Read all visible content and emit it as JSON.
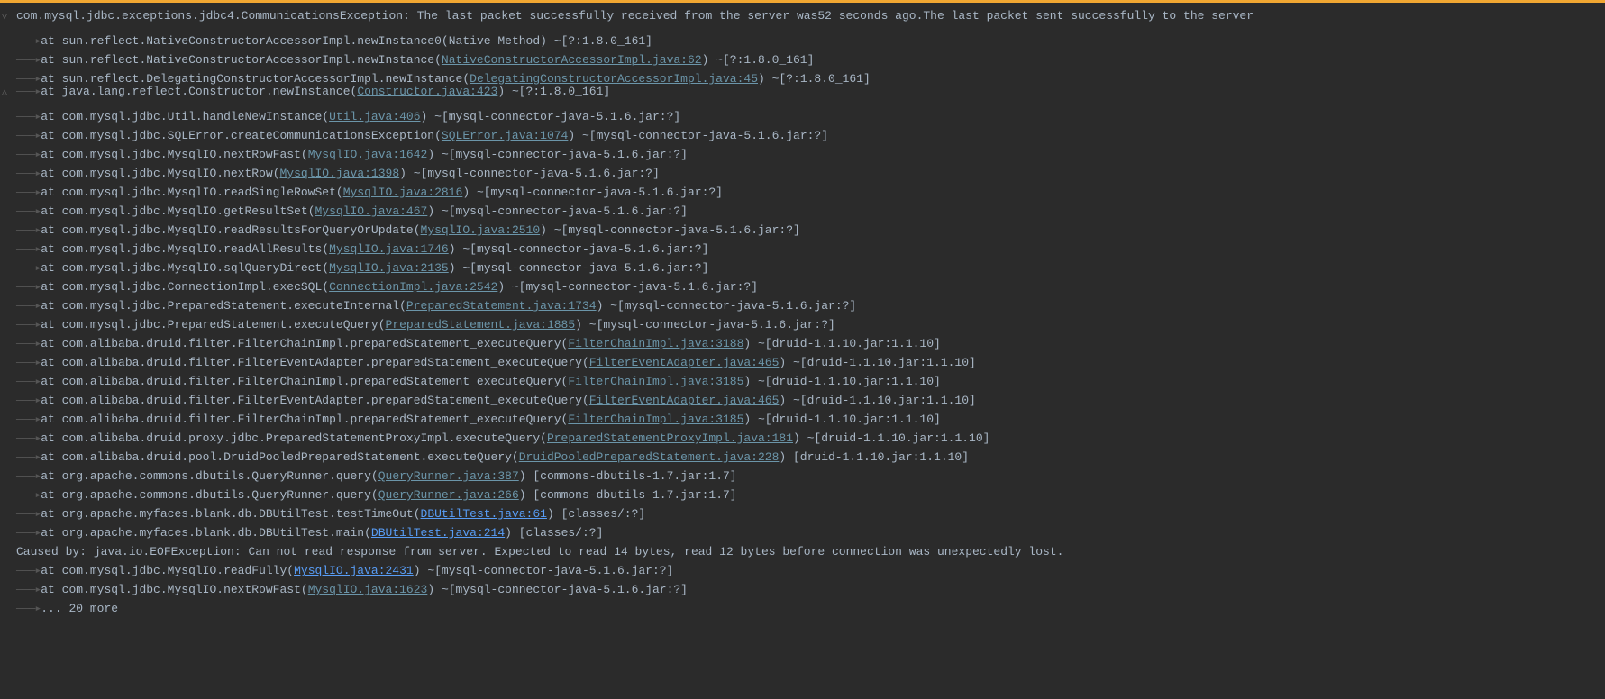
{
  "stacktrace": {
    "header": {
      "gutter": "▽",
      "exception_class": "com.mysql.jdbc.exceptions.jdbc4.CommunicationsException",
      "message": ": The last packet successfully received from the server was52 seconds ago.The last packet sent successfully to the server"
    },
    "frames": [
      {
        "gutter": "",
        "pre": "at ",
        "method": "sun.reflect.NativeConstructorAccessorImpl.newInstance0",
        "paren_open": "(",
        "link": "Native Method",
        "link_type": "plain",
        "paren_close": ")",
        "suffix": " ~[?:1.8.0_161]"
      },
      {
        "gutter": "",
        "pre": "at ",
        "method": "sun.reflect.NativeConstructorAccessorImpl.newInstance",
        "paren_open": "(",
        "link": "NativeConstructorAccessorImpl.java:62",
        "link_type": "link",
        "paren_close": ")",
        "suffix": " ~[?:1.8.0_161]"
      },
      {
        "gutter": "",
        "pre": "at ",
        "method": "sun.reflect.DelegatingConstructorAccessorImpl.newInstance",
        "paren_open": "(",
        "link": "DelegatingConstructorAccessorImpl.java:45",
        "link_type": "link",
        "paren_close": ")",
        "suffix": " ~[?:1.8.0_161]"
      },
      {
        "gutter": "△",
        "pre": "at ",
        "method": "java.lang.reflect.Constructor.newInstance",
        "paren_open": "(",
        "link": "Constructor.java:423",
        "link_type": "link",
        "paren_close": ")",
        "suffix": " ~[?:1.8.0_161]"
      },
      {
        "gutter": "",
        "pre": "at ",
        "method": "com.mysql.jdbc.Util.handleNewInstance",
        "paren_open": "(",
        "link": "Util.java:406",
        "link_type": "link",
        "paren_close": ")",
        "suffix": " ~[mysql-connector-java-5.1.6.jar:?]"
      },
      {
        "gutter": "",
        "pre": "at ",
        "method": "com.mysql.jdbc.SQLError.createCommunicationsException",
        "paren_open": "(",
        "link": "SQLError.java:1074",
        "link_type": "link",
        "paren_close": ")",
        "suffix": " ~[mysql-connector-java-5.1.6.jar:?]"
      },
      {
        "gutter": "",
        "pre": "at ",
        "method": "com.mysql.jdbc.MysqlIO.nextRowFast",
        "paren_open": "(",
        "link": "MysqlIO.java:1642",
        "link_type": "link",
        "paren_close": ")",
        "suffix": " ~[mysql-connector-java-5.1.6.jar:?]"
      },
      {
        "gutter": "",
        "pre": "at ",
        "method": "com.mysql.jdbc.MysqlIO.nextRow",
        "paren_open": "(",
        "link": "MysqlIO.java:1398",
        "link_type": "link",
        "paren_close": ")",
        "suffix": " ~[mysql-connector-java-5.1.6.jar:?]"
      },
      {
        "gutter": "",
        "pre": "at ",
        "method": "com.mysql.jdbc.MysqlIO.readSingleRowSet",
        "paren_open": "(",
        "link": "MysqlIO.java:2816",
        "link_type": "link",
        "paren_close": ")",
        "suffix": " ~[mysql-connector-java-5.1.6.jar:?]"
      },
      {
        "gutter": "",
        "pre": "at ",
        "method": "com.mysql.jdbc.MysqlIO.getResultSet",
        "paren_open": "(",
        "link": "MysqlIO.java:467",
        "link_type": "link",
        "paren_close": ")",
        "suffix": " ~[mysql-connector-java-5.1.6.jar:?]"
      },
      {
        "gutter": "",
        "pre": "at ",
        "method": "com.mysql.jdbc.MysqlIO.readResultsForQueryOrUpdate",
        "paren_open": "(",
        "link": "MysqlIO.java:2510",
        "link_type": "link",
        "paren_close": ")",
        "suffix": " ~[mysql-connector-java-5.1.6.jar:?]"
      },
      {
        "gutter": "",
        "pre": "at ",
        "method": "com.mysql.jdbc.MysqlIO.readAllResults",
        "paren_open": "(",
        "link": "MysqlIO.java:1746",
        "link_type": "link",
        "paren_close": ")",
        "suffix": " ~[mysql-connector-java-5.1.6.jar:?]"
      },
      {
        "gutter": "",
        "pre": "at ",
        "method": "com.mysql.jdbc.MysqlIO.sqlQueryDirect",
        "paren_open": "(",
        "link": "MysqlIO.java:2135",
        "link_type": "link",
        "paren_close": ")",
        "suffix": " ~[mysql-connector-java-5.1.6.jar:?]"
      },
      {
        "gutter": "",
        "pre": "at ",
        "method": "com.mysql.jdbc.ConnectionImpl.execSQL",
        "paren_open": "(",
        "link": "ConnectionImpl.java:2542",
        "link_type": "link",
        "paren_close": ")",
        "suffix": " ~[mysql-connector-java-5.1.6.jar:?]"
      },
      {
        "gutter": "",
        "pre": "at ",
        "method": "com.mysql.jdbc.PreparedStatement.executeInternal",
        "paren_open": "(",
        "link": "PreparedStatement.java:1734",
        "link_type": "link",
        "paren_close": ")",
        "suffix": " ~[mysql-connector-java-5.1.6.jar:?]"
      },
      {
        "gutter": "",
        "pre": "at ",
        "method": "com.mysql.jdbc.PreparedStatement.executeQuery",
        "paren_open": "(",
        "link": "PreparedStatement.java:1885",
        "link_type": "link",
        "paren_close": ")",
        "suffix": " ~[mysql-connector-java-5.1.6.jar:?]"
      },
      {
        "gutter": "",
        "pre": "at ",
        "method": "com.alibaba.druid.filter.FilterChainImpl.preparedStatement_executeQuery",
        "paren_open": "(",
        "link": "FilterChainImpl.java:3188",
        "link_type": "link",
        "paren_close": ")",
        "suffix": " ~[druid-1.1.10.jar:1.1.10]"
      },
      {
        "gutter": "",
        "pre": "at ",
        "method": "com.alibaba.druid.filter.FilterEventAdapter.preparedStatement_executeQuery",
        "paren_open": "(",
        "link": "FilterEventAdapter.java:465",
        "link_type": "link",
        "paren_close": ")",
        "suffix": " ~[druid-1.1.10.jar:1.1.10]"
      },
      {
        "gutter": "",
        "pre": "at ",
        "method": "com.alibaba.druid.filter.FilterChainImpl.preparedStatement_executeQuery",
        "paren_open": "(",
        "link": "FilterChainImpl.java:3185",
        "link_type": "link",
        "paren_close": ")",
        "suffix": " ~[druid-1.1.10.jar:1.1.10]"
      },
      {
        "gutter": "",
        "pre": "at ",
        "method": "com.alibaba.druid.filter.FilterEventAdapter.preparedStatement_executeQuery",
        "paren_open": "(",
        "link": "FilterEventAdapter.java:465",
        "link_type": "link",
        "paren_close": ")",
        "suffix": " ~[druid-1.1.10.jar:1.1.10]"
      },
      {
        "gutter": "",
        "pre": "at ",
        "method": "com.alibaba.druid.filter.FilterChainImpl.preparedStatement_executeQuery",
        "paren_open": "(",
        "link": "FilterChainImpl.java:3185",
        "link_type": "link",
        "paren_close": ")",
        "suffix": " ~[druid-1.1.10.jar:1.1.10]"
      },
      {
        "gutter": "",
        "pre": "at ",
        "method": "com.alibaba.druid.proxy.jdbc.PreparedStatementProxyImpl.executeQuery",
        "paren_open": "(",
        "link": "PreparedStatementProxyImpl.java:181",
        "link_type": "link",
        "paren_close": ")",
        "suffix": " ~[druid-1.1.10.jar:1.1.10]"
      },
      {
        "gutter": "",
        "pre": "at ",
        "method": "com.alibaba.druid.pool.DruidPooledPreparedStatement.executeQuery",
        "paren_open": "(",
        "link": "DruidPooledPreparedStatement.java:228",
        "link_type": "link",
        "paren_close": ")",
        "suffix": " [druid-1.1.10.jar:1.1.10]"
      },
      {
        "gutter": "",
        "pre": "at ",
        "method": "org.apache.commons.dbutils.QueryRunner.query",
        "paren_open": "(",
        "link": "QueryRunner.java:387",
        "link_type": "link",
        "paren_close": ")",
        "suffix": " [commons-dbutils-1.7.jar:1.7]"
      },
      {
        "gutter": "",
        "pre": "at ",
        "method": "org.apache.commons.dbutils.QueryRunner.query",
        "paren_open": "(",
        "link": "QueryRunner.java:266",
        "link_type": "link",
        "paren_close": ")",
        "suffix": " [commons-dbutils-1.7.jar:1.7]"
      },
      {
        "gutter": "",
        "pre": "at ",
        "method": "org.apache.myfaces.blank.db.DBUtilTest.testTimeOut",
        "paren_open": "(",
        "link": "DBUtilTest.java:61",
        "link_type": "link-bright",
        "paren_close": ")",
        "suffix": " [classes/:?]"
      },
      {
        "gutter": "",
        "pre": "at ",
        "method": "org.apache.myfaces.blank.db.DBUtilTest.main",
        "paren_open": "(",
        "link": "DBUtilTest.java:214",
        "link_type": "link-bright",
        "paren_close": ")",
        "suffix": " [classes/:?]"
      }
    ],
    "caused_by": {
      "label": "Caused by: ",
      "exception_class": "java.io.EOFException",
      "message": ": Can not read response from server. Expected to read 14 bytes, read 12 bytes before connection was unexpectedly lost."
    },
    "caused_frames": [
      {
        "gutter": "",
        "pre": "at ",
        "method": "com.mysql.jdbc.MysqlIO.readFully",
        "paren_open": "(",
        "link": "MysqlIO.java:2431",
        "link_type": "link-bright",
        "paren_close": ")",
        "suffix": " ~[mysql-connector-java-5.1.6.jar:?]"
      },
      {
        "gutter": "",
        "pre": "at ",
        "method": "com.mysql.jdbc.MysqlIO.nextRowFast",
        "paren_open": "(",
        "link": "MysqlIO.java:1623",
        "link_type": "link",
        "paren_close": ")",
        "suffix": " ~[mysql-connector-java-5.1.6.jar:?]"
      }
    ],
    "more": "... 20 more",
    "indent_prefix": "———▸"
  }
}
